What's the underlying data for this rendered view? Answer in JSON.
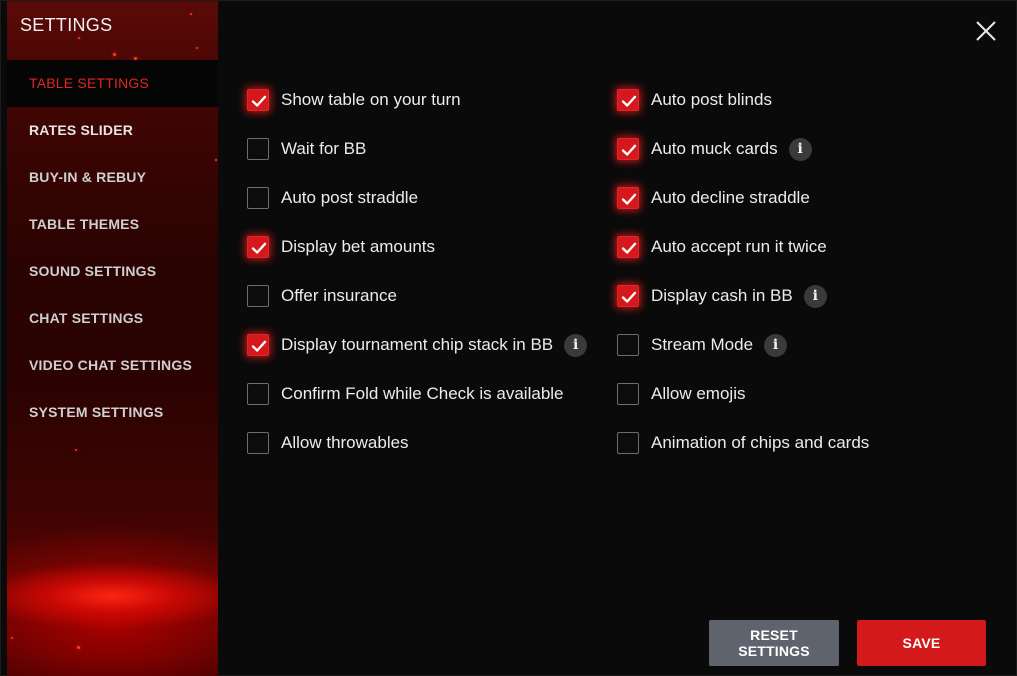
{
  "sidebar": {
    "title": "SETTINGS",
    "items": [
      {
        "label": "TABLE SETTINGS",
        "active": true
      },
      {
        "label": "RATES SLIDER",
        "active": false
      },
      {
        "label": "BUY-IN & REBUY",
        "active": false
      },
      {
        "label": "TABLE THEMES",
        "active": false
      },
      {
        "label": "SOUND SETTINGS",
        "active": false
      },
      {
        "label": "CHAT SETTINGS",
        "active": false
      },
      {
        "label": "VIDEO CHAT SETTINGS",
        "active": false
      },
      {
        "label": "SYSTEM SETTINGS",
        "active": false
      }
    ]
  },
  "header": {
    "close_icon": "close-icon"
  },
  "options": {
    "left": [
      {
        "label": "Show table on your turn",
        "checked": true,
        "info": false
      },
      {
        "label": "Wait for BB",
        "checked": false,
        "info": false
      },
      {
        "label": "Auto post straddle",
        "checked": false,
        "info": false
      },
      {
        "label": "Display bet amounts",
        "checked": true,
        "info": false
      },
      {
        "label": "Offer insurance",
        "checked": false,
        "info": false
      },
      {
        "label": "Display tournament chip stack in BB",
        "checked": true,
        "info": true
      },
      {
        "label": "Confirm Fold while Check is available",
        "checked": false,
        "info": false
      },
      {
        "label": "Allow throwables",
        "checked": false,
        "info": false
      }
    ],
    "right": [
      {
        "label": "Auto post blinds",
        "checked": true,
        "info": false
      },
      {
        "label": "Auto muck cards",
        "checked": true,
        "info": true
      },
      {
        "label": "Auto decline straddle",
        "checked": true,
        "info": false
      },
      {
        "label": "Auto accept run it twice",
        "checked": true,
        "info": false
      },
      {
        "label": "Display cash in BB",
        "checked": true,
        "info": true
      },
      {
        "label": "Stream Mode",
        "checked": false,
        "info": true
      },
      {
        "label": "Allow emojis",
        "checked": false,
        "info": false
      },
      {
        "label": "Animation of chips and cards",
        "checked": false,
        "info": false
      }
    ],
    "info_glyph": "i"
  },
  "footer": {
    "reset_label": "RESET SETTINGS",
    "save_label": "SAVE"
  },
  "colors": {
    "accent": "#d4181b",
    "active_nav_text": "#e0261f",
    "reset_button": "#5e636d",
    "background": "#0a0a0a"
  }
}
